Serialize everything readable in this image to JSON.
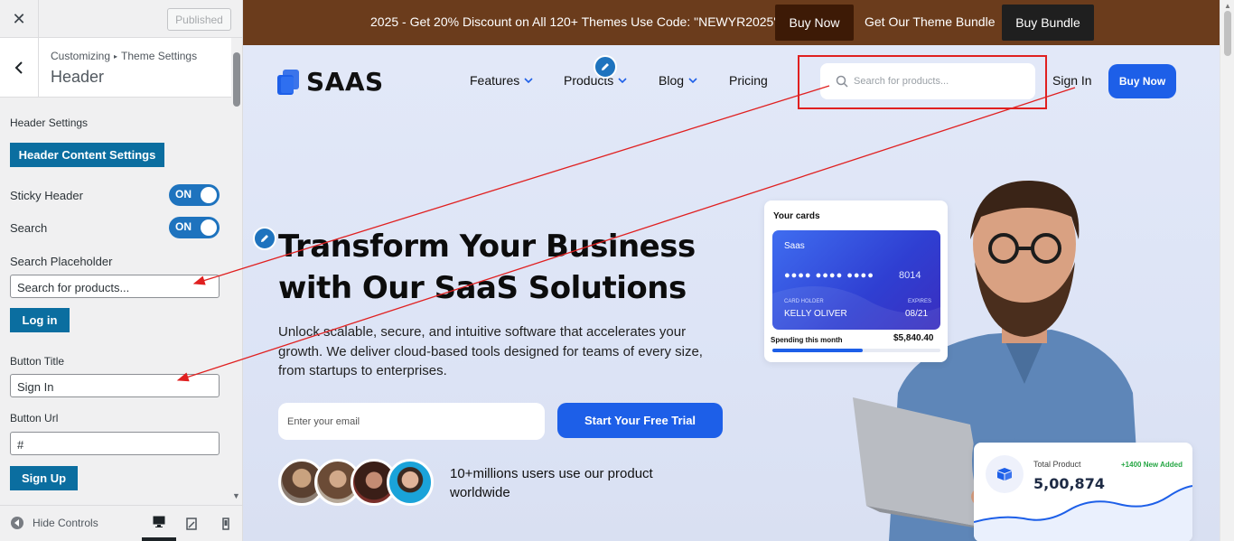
{
  "customizer": {
    "published_label": "Published",
    "breadcrumb": {
      "root": "Customizing",
      "parent": "Theme Settings"
    },
    "section_title": "Header",
    "group_label": "Header Settings",
    "content_settings_button": "Header Content Settings",
    "sticky_header": {
      "label": "Sticky Header",
      "state": "ON"
    },
    "search": {
      "label": "Search",
      "state": "ON"
    },
    "search_placeholder": {
      "label": "Search Placeholder",
      "value": "Search for products..."
    },
    "login_button": "Log in",
    "button_title": {
      "label": "Button Title",
      "value": "Sign In"
    },
    "button_url": {
      "label": "Button Url",
      "value": "#"
    },
    "signup_button": "Sign Up",
    "hide_controls": "Hide Controls",
    "accent_color": "#0b6ea0",
    "toggle_color": "#1e73be"
  },
  "preview": {
    "promo": {
      "text": "2025 - Get 20% Discount on All 120+ Themes Use Code: \"NEWYR2025\"",
      "buy_now": "Buy Now",
      "bundle_text": "Get Our Theme Bundle",
      "buy_bundle": "Buy Bundle",
      "bg_color": "#6b3c1c"
    },
    "logo": "SAAS",
    "nav": [
      "Features",
      "Products",
      "Blog",
      "Pricing"
    ],
    "search_placeholder": "Search for products...",
    "sign_in": "Sign In",
    "buy_now": "Buy Now",
    "hero": {
      "title_line1": "Transform Your Business",
      "title_line2": "with Our SaaS Solutions",
      "description": "Unlock scalable, secure, and intuitive software that accelerates your growth. We deliver cloud-based tools designed for teams of every size, from startups to enterprises.",
      "email_placeholder": "Enter your email",
      "cta": "Start Your Free Trial",
      "users_text": "10+millions users use our product worldwide"
    },
    "card_widget": {
      "title": "Your cards",
      "brand": "Saas",
      "masked_number": "●●●● ●●●● ●●●●",
      "last_digits": "8014",
      "holder_label": "CARD HOLDER",
      "holder_name": "KELLY OLIVER",
      "expiry_label": "EXPIRES",
      "expiry": "08/21",
      "spending_label": "Spending this month",
      "spending_value": "$5,840.40",
      "spending_progress": 0.54
    },
    "product_widget": {
      "label": "Total Product",
      "new_added": "+1400 New Added",
      "value": "5,00,874"
    },
    "brand_color": "#1d5fe8"
  }
}
